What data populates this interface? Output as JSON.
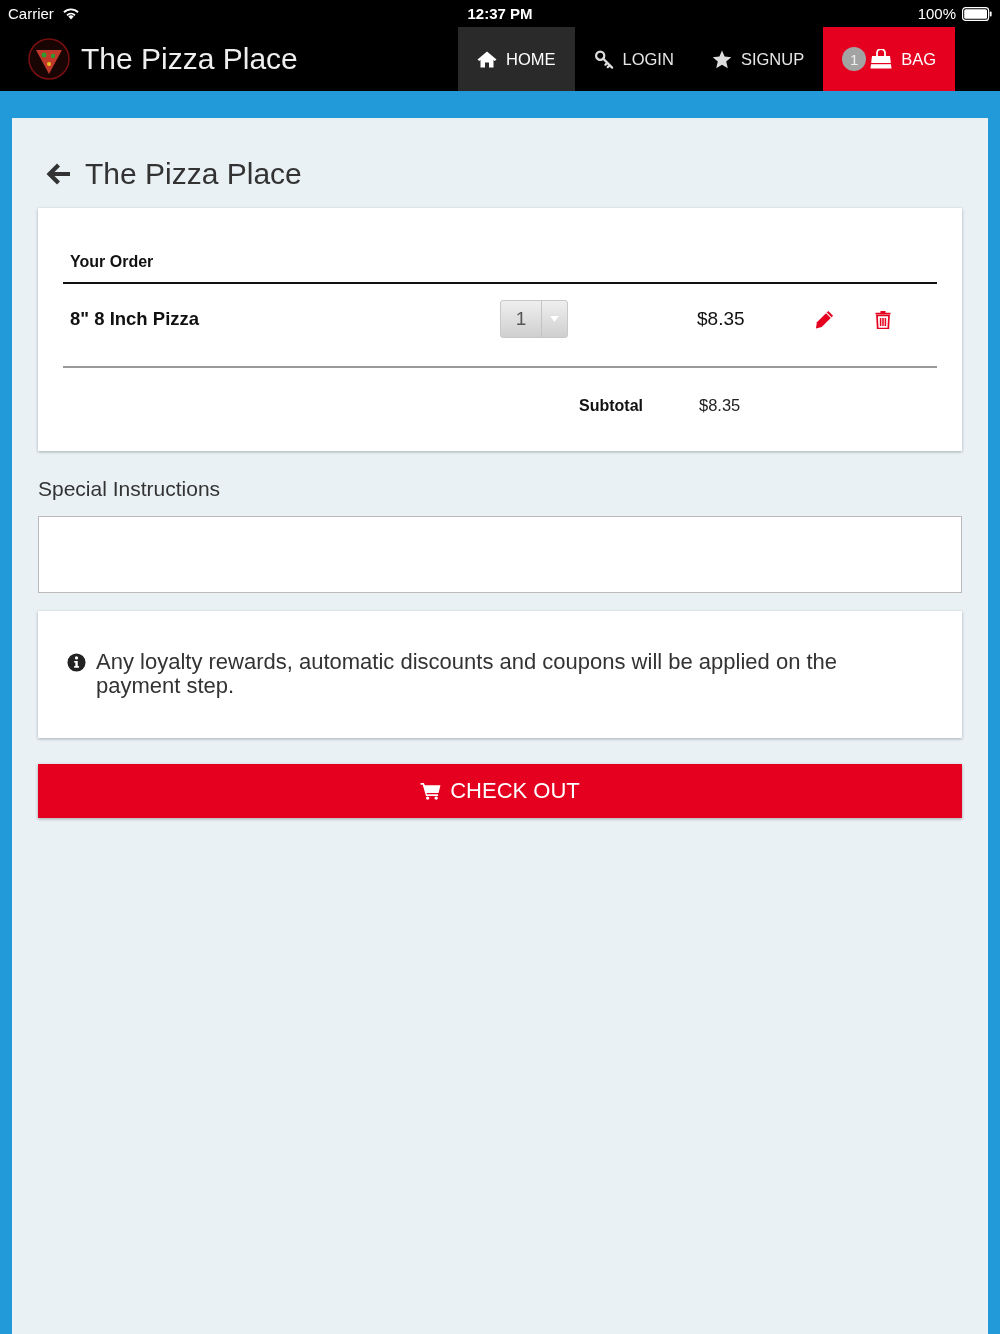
{
  "status_bar": {
    "carrier": "Carrier",
    "time": "12:37 PM",
    "battery": "100%"
  },
  "nav": {
    "brand": "The Pizza Place",
    "tabs": [
      {
        "label": "HOME",
        "kind": "home",
        "selected": true
      },
      {
        "label": "LOGIN",
        "kind": "login",
        "selected": false
      },
      {
        "label": "SIGNUP",
        "kind": "signup",
        "selected": false
      },
      {
        "label": "BAG",
        "kind": "bag",
        "selected": false,
        "badge": "1"
      }
    ]
  },
  "page": {
    "title": "The Pizza Place"
  },
  "order": {
    "heading": "Your Order",
    "items": [
      {
        "name": "8\" 8 Inch Pizza",
        "quantity": "1",
        "price": "$8.35"
      }
    ],
    "subtotal_label": "Subtotal",
    "subtotal": "$8.35"
  },
  "special_instructions": {
    "label": "Special Instructions"
  },
  "notice": {
    "text": "Any loyalty rewards, automatic discounts and coupons will be applied on the payment step."
  },
  "checkout_button": {
    "label": "CHECK OUT"
  }
}
